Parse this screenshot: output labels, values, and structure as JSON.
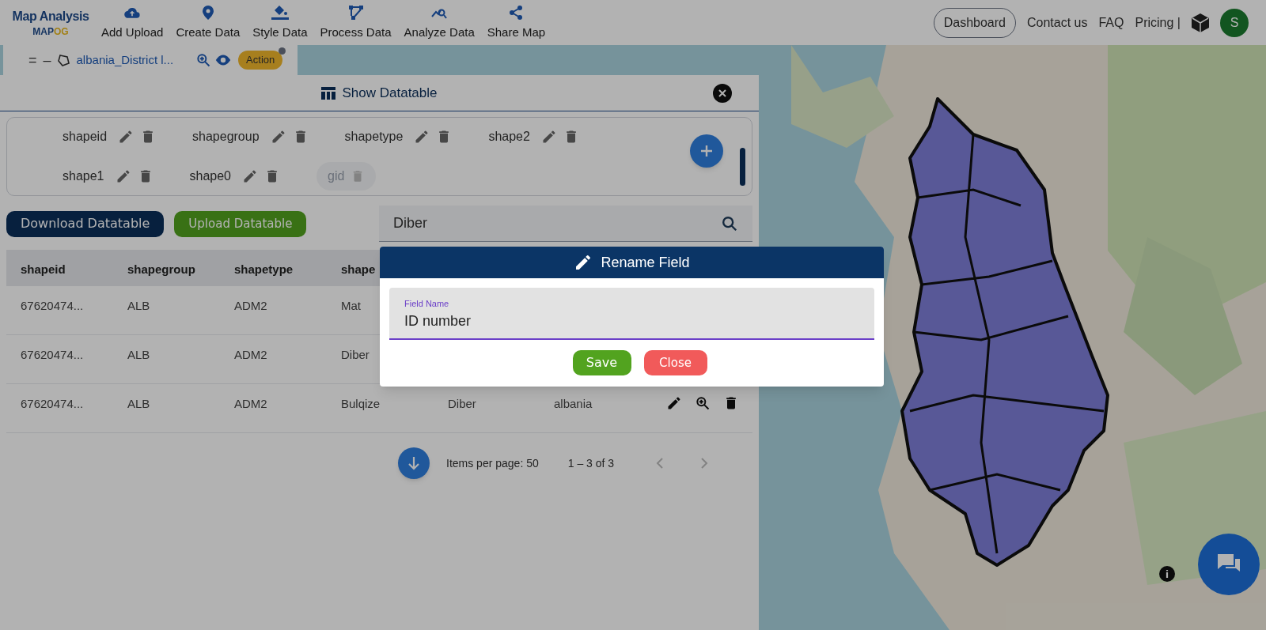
{
  "app_bar": {
    "title": "Map Analysis",
    "logo_parts": [
      "MAP",
      "OG"
    ],
    "nav": [
      {
        "label": "Add Upload"
      },
      {
        "label": "Create Data"
      },
      {
        "label": "Style Data"
      },
      {
        "label": "Process Data"
      },
      {
        "label": "Analyze Data"
      },
      {
        "label": "Share Map"
      }
    ],
    "dashboard": "Dashboard",
    "links": [
      "Contact us",
      "FAQ",
      "Pricing |"
    ],
    "avatar": "S"
  },
  "layer_bar": {
    "handle": "=",
    "collapse": "–",
    "name": "albania_District l...",
    "action": "Action"
  },
  "datatable": {
    "title": "Show Datatable",
    "fields": [
      {
        "label": "shapeid",
        "disabled": false
      },
      {
        "label": "shapegroup",
        "disabled": false
      },
      {
        "label": "shapetype",
        "disabled": false
      },
      {
        "label": "shape2",
        "disabled": false
      },
      {
        "label": "shape1",
        "disabled": false
      },
      {
        "label": "shape0",
        "disabled": false
      },
      {
        "label": "gid",
        "disabled": true
      }
    ],
    "download": "Download Datatable",
    "upload": "Upload Datatable",
    "search": "Diber",
    "columns": [
      "shapeid",
      "shapegroup",
      "shapetype",
      "shape"
    ],
    "rows": [
      {
        "cells": [
          "67620474...",
          "ALB",
          "ADM2",
          "Mat"
        ]
      },
      {
        "cells": [
          "67620474...",
          "ALB",
          "ADM2",
          "Diber"
        ]
      },
      {
        "cells": [
          "67620474...",
          "ALB",
          "ADM2",
          "Bulqize",
          "Diber",
          "albania"
        ]
      }
    ],
    "items_per_page": "Items per page: 50",
    "range": "1 – 3 of 3"
  },
  "dialog": {
    "title": "Rename Field",
    "field_label": "Field Name",
    "value": "ID number",
    "save": "Save",
    "close": "Close"
  }
}
